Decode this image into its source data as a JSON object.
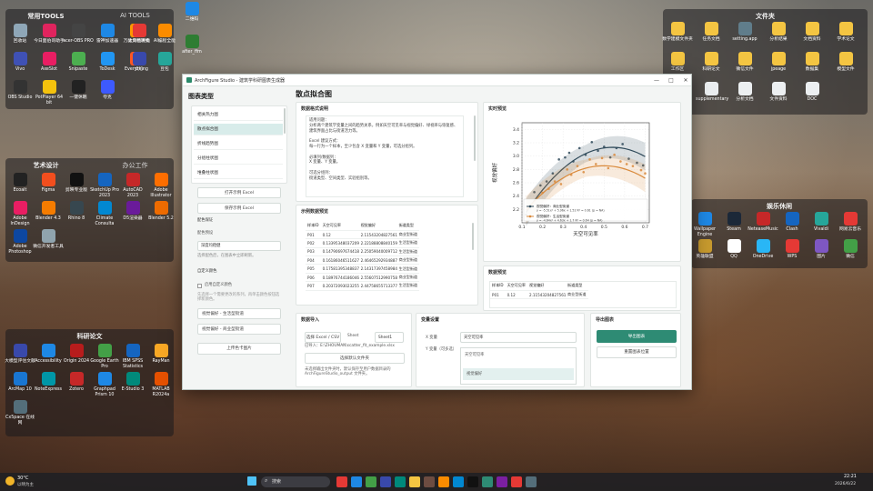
{
  "desktop": {
    "left_icons": [
      {
        "label": "回收站",
        "color": "#8fa7b8"
      },
      {
        "label": "今日面伯哥助手",
        "color": "#e0245e"
      },
      {
        "label": "acer-OBS PRO",
        "color": "#444"
      },
      {
        "label": "雷神加速器",
        "color": "#1e88e5"
      },
      {
        "label": "万能文档转换",
        "color": "#ff9800"
      },
      {
        "label": "Vivo",
        "color": "#3f51b5"
      },
      {
        "label": "AxeSlot",
        "color": "#e91e63"
      },
      {
        "label": "Snipaste",
        "color": "#4caf50"
      },
      {
        "label": "ToDesk",
        "color": "#2196f3"
      },
      {
        "label": "Everything",
        "color": "#ff5722"
      },
      {
        "label": "OBS Studio",
        "color": "#333"
      },
      {
        "label": "PotPlayer 64 bit",
        "color": "#f4c20d"
      },
      {
        "label": "一键休眠",
        "color": "#222"
      },
      {
        "label": "夸克",
        "color": "#3d5afe"
      }
    ],
    "top_icons": [
      {
        "label": "二维码",
        "color": "#1e88e5"
      },
      {
        "label": "after_ffm",
        "color": "#2e7d32"
      }
    ],
    "group_common": "常用TOOLS",
    "group_ai": "AI TOOLS",
    "ai_icons": [
      {
        "label": "太阳能发电",
        "color": "#e53935"
      },
      {
        "label": "AI编程全能",
        "color": "#fb8c00"
      },
      {
        "label": "文心",
        "color": "#3949ab"
      },
      {
        "label": "豆包",
        "color": "#26a69a"
      }
    ],
    "group_art": "艺术设计",
    "group_office": "办公工作",
    "art_icons": [
      {
        "label": "Ecoalt",
        "color": "#222"
      },
      {
        "label": "Figma",
        "color": "#f24e1e"
      },
      {
        "label": "剪映专业版",
        "color": "#111"
      },
      {
        "label": "SketchUp Pro 2023",
        "color": "#1565c0"
      },
      {
        "label": "AutoCAD 2023",
        "color": "#c62828"
      },
      {
        "label": "Adobe Illustrator",
        "color": "#ff6f00"
      },
      {
        "label": "Adobe InDesign",
        "color": "#e91e63"
      },
      {
        "label": "Blender 4.3",
        "color": "#f57c00"
      },
      {
        "label": "Rhino 8",
        "color": "#37474f"
      },
      {
        "label": "Climate Consulta",
        "color": "#0288d1"
      },
      {
        "label": "D5渲染器",
        "color": "#6a1b9a"
      },
      {
        "label": "Blender 5.2",
        "color": "#ef6c00"
      },
      {
        "label": "Adobe Photoshop",
        "color": "#0d47a1"
      },
      {
        "label": "微信开发者工具",
        "color": "#90a4ae"
      }
    ],
    "group_research": "科研论文",
    "research_icons": [
      {
        "label": "大模型评估文献",
        "color": "#3949ab"
      },
      {
        "label": "Accessibility",
        "color": "#1e88e5"
      },
      {
        "label": "Origin 2024",
        "color": "#b71c1c"
      },
      {
        "label": "Google Earth Pro",
        "color": "#43a047"
      },
      {
        "label": "IBM SPSS Statistics",
        "color": "#1565c0"
      },
      {
        "label": "RayMan",
        "color": "#f9a825"
      },
      {
        "label": "ArcMap 10",
        "color": "#1976d2"
      },
      {
        "label": "NoteExpress",
        "color": "#0097a7"
      },
      {
        "label": "Zotero",
        "color": "#c62828"
      },
      {
        "label": "Graphpad Prism 10",
        "color": "#1e88e5"
      },
      {
        "label": "E-Studio 3",
        "color": "#00897b"
      },
      {
        "label": "MATLAB R2024a",
        "color": "#e65100"
      },
      {
        "label": "Cx5pace 在线网",
        "color": "#546e7a"
      }
    ],
    "group_files": "文件夹",
    "file_icons": [
      {
        "label": "数学建模文件夹",
        "color": "#f4c542"
      },
      {
        "label": "任务文档",
        "color": "#f4c542"
      },
      {
        "label": "setting.app",
        "color": "#607d8b"
      },
      {
        "label": "分析结果",
        "color": "#f4c542"
      },
      {
        "label": "文档资料",
        "color": "#f4c542"
      },
      {
        "label": "学术论文",
        "color": "#f4c542"
      },
      {
        "label": "工作区",
        "color": "#f4c542"
      },
      {
        "label": "科研论文",
        "color": "#f4c542"
      },
      {
        "label": "微信文件",
        "color": "#f4c542"
      },
      {
        "label": "jpeage",
        "color": "#f4c542"
      },
      {
        "label": "数据集",
        "color": "#f4c542"
      },
      {
        "label": "模型文件",
        "color": "#f4c542"
      },
      {
        "label": "数据建模ggm",
        "color": "#f4c542"
      },
      {
        "label": "supplementary",
        "color": "#eceff1"
      },
      {
        "label": "分析文档",
        "color": "#eceff1"
      },
      {
        "label": "文件资料",
        "color": "#eceff1"
      },
      {
        "label": "DOC",
        "color": "#eceff1"
      }
    ],
    "group_leisure": "娱乐休闲",
    "leisure_icons": [
      {
        "label": "Wallpaper Engine",
        "color": "#1e88e5"
      },
      {
        "label": "Steam",
        "color": "#1b2838"
      },
      {
        "label": "NeteaseMusic",
        "color": "#c62828"
      },
      {
        "label": "Clash",
        "color": "#1565c0"
      },
      {
        "label": "Vivaldi",
        "color": "#26a69a"
      },
      {
        "label": "网易云音乐",
        "color": "#e53935"
      },
      {
        "label": "英雄联盟",
        "color": "#c79a2e"
      },
      {
        "label": "QQ",
        "color": "#fff"
      },
      {
        "label": "OneDrive",
        "color": "#29b6f6"
      },
      {
        "label": "WPS",
        "color": "#e53935"
      },
      {
        "label": "图片",
        "color": "#7e57c2"
      },
      {
        "label": "微信",
        "color": "#43a047"
      }
    ]
  },
  "window": {
    "title": "ArchFigure Studio - 建筑学科研图表生成器",
    "controls": [
      "—",
      "□",
      "✕"
    ],
    "sidebar_title": "图表类型",
    "chart_types": [
      "相关热力图",
      "散点拟合图",
      "折线趋势图",
      "分组柱状图",
      "堆叠柱状图"
    ],
    "open_example": "打开示例 Excel",
    "save_example": "保存示例 Excel",
    "palette_title": "配色保证",
    "palette_label": "配色预设",
    "palette_value": "深度均稳健",
    "palette_note": "选择配色后，在图表中立即刷新。",
    "custom_title": "自定义颜色",
    "custom_checkbox": "启用自定义颜色",
    "custom_note": "先选择一个需要更改的系列，再单击颜色按钮选择新颜色。",
    "series_items": [
      "视觉偏好 - 生活型街道",
      "视觉偏好 - 商业型街道"
    ],
    "upload_button": "上传色卡图片"
  },
  "main": {
    "title": "散点拟合图",
    "desc_title": "数据格式说明",
    "desc_lines": [
      "适用问题：",
      "分析两个建筑学变量之间的趋势关系，例如天空可见率与视觉偏好、绿视率与恢复感、建筑界面占比与街道活力等。",
      "",
      "Excel 建议方式：",
      "每一行为一个样本，至少包含 X 变量和 Y 变量，可选分组列。",
      "",
      "必填列/数据列：",
      "X 变量、Y 变量。",
      "",
      "可选分组列：",
      "街道类型、空间类型、实验组别等。"
    ],
    "sample_title": "示例数据预览",
    "sample_headers": [
      "样本ID",
      "天空可见率",
      "视觉偏好",
      "街道类型"
    ],
    "sample_rows": [
      [
        "P01",
        "0.12",
        "2.11543204827561",
        "商业型街道"
      ],
      [
        "P02",
        "0.133953480372093",
        "2.22188808840159",
        "生活型街道"
      ],
      [
        "P03",
        "0.147906976744186",
        "2.250590400097129",
        "生活型街道"
      ],
      [
        "P04",
        "0.161860465116279",
        "2.464652929348875",
        "商业型街道"
      ],
      [
        "P05",
        "0.175813953488372",
        "2.143173974589845",
        "生活型街道"
      ],
      [
        "P06",
        "0.189767441860465",
        "2.556075129907581",
        "商业型街道"
      ],
      [
        "P07",
        "0.203720930232558",
        "2.447586557133773",
        "生活型街道"
      ]
    ],
    "preview_title": "实时预览",
    "data_preview_title": "数据预览",
    "data_headers": [
      "样本ID",
      "天空可见率",
      "视觉偏好",
      "街道类型"
    ],
    "data_row": [
      "P01",
      "0.12",
      "2.11543204827561",
      "商业型街道"
    ],
    "import_title": "数据导入",
    "import_button": "选择 Excel / CSV",
    "sheet_label": "Sheet",
    "sheet_value": "Sheet1",
    "file_path": "已导入：E:\\ZHOUMAN\\scatter_fit_example.xlsx",
    "default_button": "选择默认文件夹",
    "save_note": "未选择输出文件夹时，默认保存至用户数据目录的 ArchFigureStudio_output 文件夹。",
    "vars_title": "变量设置",
    "x_label": "X 变量",
    "x_value": "天空可见率",
    "y_label": "Y 变量（可多选）",
    "y_options": [
      "天空可见率",
      "视觉偏好"
    ],
    "export_title": "导出图表",
    "export_button": "导出图表",
    "reset_button": "重置图表位置"
  },
  "chart_data": {
    "type": "scatter",
    "xlabel": "天空可见率",
    "ylabel": "视觉偏好",
    "xlim": [
      0.1,
      0.72
    ],
    "ylim": [
      2.0,
      3.5
    ],
    "xticks": [
      "0.1",
      "0.2",
      "0.3",
      "0.4",
      "0.5",
      "0.6",
      "0.7"
    ],
    "yticks": [
      "2.2",
      "2.4",
      "2.6",
      "2.8",
      "3.0",
      "3.2",
      "3.4"
    ],
    "legend_placement": "bottom-left",
    "series": [
      {
        "name": "视觉偏好：商业型街道",
        "fit": "y = -5.51x² + 5.96x + 1.52  R² = 0.61  (p = NA)",
        "color": "#2f4a5a",
        "points": [
          [
            0.12,
            2.12
          ],
          [
            0.16,
            2.46
          ],
          [
            0.19,
            2.56
          ],
          [
            0.22,
            2.62
          ],
          [
            0.25,
            2.74
          ],
          [
            0.28,
            2.95
          ],
          [
            0.31,
            2.98
          ],
          [
            0.33,
            3.05
          ],
          [
            0.35,
            2.92
          ],
          [
            0.38,
            3.12
          ],
          [
            0.41,
            3.02
          ],
          [
            0.44,
            3.21
          ],
          [
            0.47,
            3.08
          ],
          [
            0.5,
            3.14
          ],
          [
            0.53,
            2.98
          ],
          [
            0.56,
            3.12
          ],
          [
            0.59,
            3.18
          ],
          [
            0.62,
            2.96
          ],
          [
            0.66,
            2.9
          ],
          [
            0.69,
            2.86
          ]
        ],
        "fit_coef": [
          -5.51,
          5.96,
          1.52
        ]
      },
      {
        "name": "视觉偏好：生活型街道",
        "fit": "y = -4.64x² + 4.63x + 1.7  R² = 0.64  (p = NA)",
        "color": "#d98a3c",
        "points": [
          [
            0.13,
            2.22
          ],
          [
            0.15,
            2.25
          ],
          [
            0.18,
            2.14
          ],
          [
            0.2,
            2.45
          ],
          [
            0.23,
            2.51
          ],
          [
            0.26,
            2.62
          ],
          [
            0.29,
            2.58
          ],
          [
            0.32,
            2.8
          ],
          [
            0.34,
            2.72
          ],
          [
            0.37,
            2.85
          ],
          [
            0.4,
            2.76
          ],
          [
            0.43,
            2.95
          ],
          [
            0.46,
            2.88
          ],
          [
            0.49,
            2.97
          ],
          [
            0.52,
            2.82
          ],
          [
            0.55,
            3.02
          ],
          [
            0.58,
            2.92
          ],
          [
            0.61,
            2.88
          ],
          [
            0.64,
            2.85
          ],
          [
            0.68,
            2.79
          ],
          [
            0.7,
            2.74
          ]
        ],
        "fit_coef": [
          -4.64,
          4.63,
          1.7
        ]
      }
    ]
  },
  "taskbar": {
    "weather": "30°C",
    "weather_sub": "以晴为主",
    "search": "搜索",
    "time": "22:21",
    "date": "2026/6/22"
  }
}
